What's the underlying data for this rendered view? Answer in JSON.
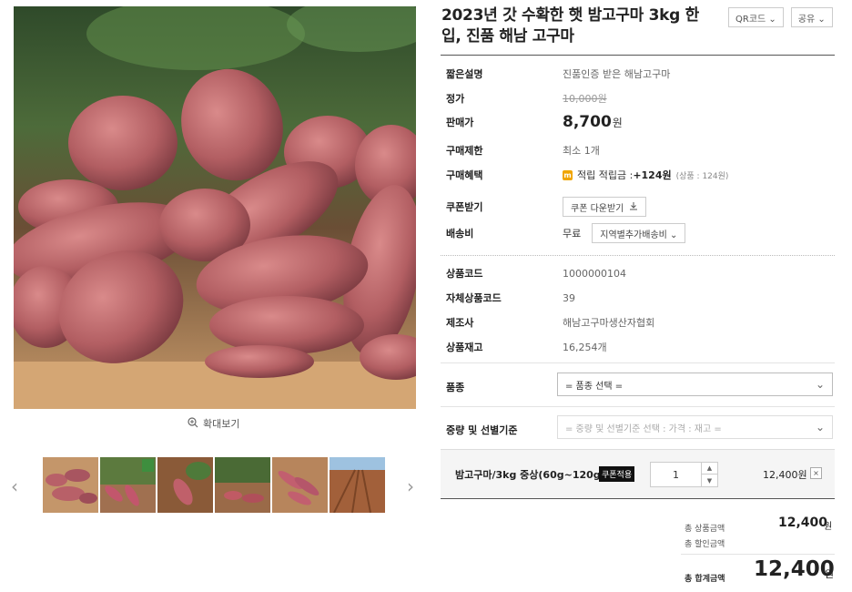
{
  "product": {
    "title": "2023년 갓 수확한 햇 밤고구마 3kg 한입, 진품 해남 고구마",
    "zoom_label": "확대보기"
  },
  "top_buttons": {
    "qr": "QR코드 ⌄",
    "share": "공유 ⌄"
  },
  "info": {
    "short_desc_label": "짧은설명",
    "short_desc": "진품인증 받은 해남고구마",
    "list_price_label": "정가",
    "list_price": "10,000원",
    "sale_price_label": "판매가",
    "sale_price": "8,700",
    "sale_price_unit": "원",
    "purchase_limit_label": "구매제한",
    "purchase_limit": "최소 1개",
    "benefit_label": "구매혜택",
    "benefit_icon": "m",
    "benefit_prefix": "적립 적립금 : ",
    "benefit_amount": "+124원",
    "benefit_note": "(상품 : 124원)",
    "coupon_label": "쿠폰받기",
    "coupon_button": "쿠폰 다운받기",
    "shipping_label": "배송비",
    "shipping_value": "무료",
    "shipping_button": "지역별추가배송비 ⌄"
  },
  "codes": {
    "product_code_label": "상품코드",
    "product_code": "1000000104",
    "own_code_label": "자체상품코드",
    "own_code": "39",
    "maker_label": "제조사",
    "maker": "해남고구마생산자협회",
    "stock_label": "상품재고",
    "stock": "16,254개"
  },
  "options": {
    "variety_label": "품종",
    "variety_placeholder": "= 품종 선택 =",
    "weight_label": "중량 및 선별기준",
    "weight_placeholder": "= 중량 및 선별기준 선택 : 가격 : 재고 ="
  },
  "selected_option": {
    "name": "밤고구마/3kg 중상(60g~120g)",
    "coupon_tag": "쿠폰적용",
    "quantity": "1",
    "price": "12,400원",
    "remove": "×"
  },
  "summary": {
    "total_product_label": "총 상품금액",
    "total_product": "12,400",
    "total_product_unit": "원",
    "discount_label": "총 할인금액",
    "total_label": "총 합계금액",
    "total": "12,400",
    "total_unit": "원"
  }
}
